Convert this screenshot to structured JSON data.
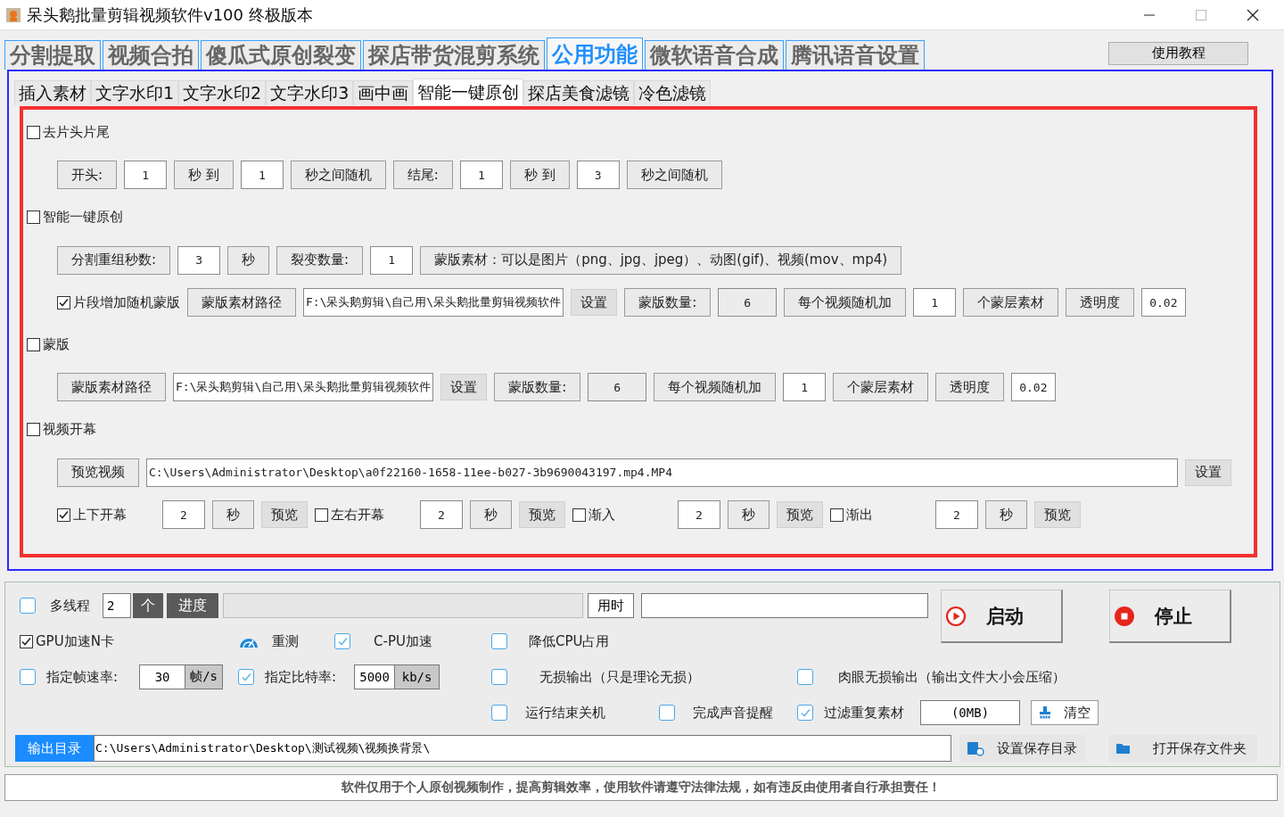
{
  "window": {
    "title": "呆头鹅批量剪辑视频软件v100 终极版本"
  },
  "main_tabs": [
    {
      "label": "分割提取",
      "selected": false
    },
    {
      "label": "视频合拍",
      "selected": false
    },
    {
      "label": "傻瓜式原创裂变",
      "selected": false
    },
    {
      "label": "探店带货混剪系统",
      "selected": false
    },
    {
      "label": "公用功能",
      "selected": true
    },
    {
      "label": "微软语音合成",
      "selected": false
    },
    {
      "label": "腾讯语音设置",
      "selected": false
    }
  ],
  "help_button": "使用教程",
  "sub_tabs": [
    {
      "label": "插入素材",
      "selected": false
    },
    {
      "label": "文字水印1",
      "selected": false
    },
    {
      "label": "文字水印2",
      "selected": false
    },
    {
      "label": "文字水印3",
      "selected": false
    },
    {
      "label": "画中画",
      "selected": false
    },
    {
      "label": "智能一键原创",
      "selected": true
    },
    {
      "label": "探店美食滤镜",
      "selected": false
    },
    {
      "label": "冷色滤镜",
      "selected": false
    }
  ],
  "sections": [
    {
      "checkbox": {
        "label": "去片头片尾",
        "checked": false
      },
      "rows": [
        {
          "controls": [
            {
              "kind": "tag",
              "text": "开头:"
            },
            {
              "kind": "field",
              "value": "1"
            },
            {
              "kind": "tag",
              "text": "秒 到"
            },
            {
              "kind": "field",
              "value": "1"
            },
            {
              "kind": "tag",
              "text": "秒之间随机"
            },
            {
              "kind": "tag",
              "text": "结尾:"
            },
            {
              "kind": "field",
              "value": "1"
            },
            {
              "kind": "tag",
              "text": "秒 到"
            },
            {
              "kind": "field",
              "value": "3"
            },
            {
              "kind": "tag",
              "text": "秒之间随机"
            }
          ]
        }
      ]
    },
    {
      "checkbox": {
        "label": "智能一键原创",
        "checked": false
      },
      "rows": [
        {
          "controls": [
            {
              "kind": "tag",
              "text": "分割重组秒数:"
            },
            {
              "kind": "field",
              "value": "3"
            },
            {
              "kind": "tag",
              "text": "秒"
            },
            {
              "kind": "tag",
              "text": "裂变数量:"
            },
            {
              "kind": "field",
              "value": "1"
            },
            {
              "kind": "tag",
              "text": "蒙版素材：可以是图片（png、jpg、jpeg）、动图(gif)、视频(mov、mp4)"
            }
          ]
        },
        {
          "controls": [
            {
              "kind": "check",
              "label": "片段增加随机蒙版",
              "checked": true
            },
            {
              "kind": "tag",
              "text": "蒙版素材路径"
            },
            {
              "kind": "path",
              "value": "F:\\呆头鹅剪辑\\自己用\\呆头鹅批量剪辑视频软件"
            },
            {
              "kind": "button",
              "text": "设置"
            },
            {
              "kind": "tag",
              "text": "蒙版数量:"
            },
            {
              "kind": "readout",
              "value": "6"
            },
            {
              "kind": "tag",
              "text": "每个视频随机加"
            },
            {
              "kind": "field",
              "value": "1"
            },
            {
              "kind": "tag",
              "text": "个蒙层素材"
            },
            {
              "kind": "tag",
              "text": "透明度"
            },
            {
              "kind": "field",
              "value": "0.02"
            }
          ]
        }
      ]
    },
    {
      "checkbox": {
        "label": "蒙版",
        "checked": false
      },
      "rows": [
        {
          "controls": [
            {
              "kind": "tag",
              "text": "蒙版素材路径"
            },
            {
              "kind": "path",
              "value": "F:\\呆头鹅剪辑\\自己用\\呆头鹅批量剪辑视频软件"
            },
            {
              "kind": "button",
              "text": "设置"
            },
            {
              "kind": "tag",
              "text": "蒙版数量:"
            },
            {
              "kind": "readout",
              "value": "6"
            },
            {
              "kind": "tag",
              "text": "每个视频随机加"
            },
            {
              "kind": "field",
              "value": "1"
            },
            {
              "kind": "tag",
              "text": "个蒙层素材"
            },
            {
              "kind": "tag",
              "text": "透明度"
            },
            {
              "kind": "field",
              "value": "0.02"
            }
          ]
        }
      ]
    },
    {
      "checkbox": {
        "label": "视频开幕",
        "checked": false
      },
      "rows": [
        {
          "controls": [
            {
              "kind": "tag",
              "text": "预览视频"
            },
            {
              "kind": "longfield",
              "value": "C:\\Users\\Administrator\\Desktop\\a0f22160-1658-11ee-b027-3b9690043197.mp4.MP4"
            },
            {
              "kind": "button",
              "text": "设置"
            }
          ]
        },
        {
          "controls": [
            {
              "kind": "check",
              "label": "上下开幕",
              "checked": true
            },
            {
              "kind": "field",
              "value": "2"
            },
            {
              "kind": "tag",
              "text": "秒"
            },
            {
              "kind": "button",
              "text": "预览"
            },
            {
              "kind": "check",
              "label": "左右开幕",
              "checked": false
            },
            {
              "kind": "field",
              "value": "2"
            },
            {
              "kind": "tag",
              "text": "秒"
            },
            {
              "kind": "button",
              "text": "预览"
            },
            {
              "kind": "check",
              "label": "渐入",
              "checked": false
            },
            {
              "kind": "field",
              "value": "2"
            },
            {
              "kind": "tag",
              "text": "秒"
            },
            {
              "kind": "button",
              "text": "预览"
            },
            {
              "kind": "check",
              "label": "渐出",
              "checked": false
            },
            {
              "kind": "field",
              "value": "2"
            },
            {
              "kind": "tag",
              "text": "秒"
            },
            {
              "kind": "button",
              "text": "预览"
            }
          ]
        }
      ]
    }
  ],
  "options": {
    "multithread": {
      "label": "多线程",
      "checked": false,
      "count": "2",
      "unit": "个"
    },
    "progress": {
      "label": "进度",
      "level": 0
    },
    "elapsed": {
      "label": "用时"
    },
    "start_button": "启动",
    "stop_button": "停止",
    "gpu": {
      "label": "GPU加速N卡",
      "checked": true
    },
    "retest_button": "重测",
    "cpu_accel": {
      "label": "C-PU加速",
      "checked": true
    },
    "reduce_cpu": {
      "label": "降低CPU占用",
      "checked": false
    },
    "frame_rate": {
      "label": "指定帧速率:",
      "checked": false,
      "value": "30",
      "unit": "帧/s"
    },
    "bitrate": {
      "label": "指定比特率:",
      "checked": true,
      "value": "5000",
      "unit": "kb/s"
    },
    "lossless": {
      "label": "无损输出（只是理论无损）",
      "checked": false
    },
    "visual_lossless": {
      "label": "肉眼无损输出（输出文件大小会压缩）",
      "checked": false
    },
    "shutdown": {
      "label": "运行结束关机",
      "checked": false
    },
    "sound": {
      "label": "完成声音提醒",
      "checked": false
    },
    "dedupe": {
      "label": "过滤重复素材",
      "checked": true,
      "value": "(0MB)"
    },
    "clear_button": "清空",
    "output_dir": {
      "label": "输出目录",
      "value": "C:\\Users\\Administrator\\Desktop\\测试视频\\视频换背景\\"
    },
    "set_dir_button": "设置保存目录",
    "open_dir_button": "打开保存文件夹"
  },
  "notice": "软件仅用于个人原创视频制作，提高剪辑效率，使用软件请遵守法律法规，如有违反由使用者自行承担责任！"
}
